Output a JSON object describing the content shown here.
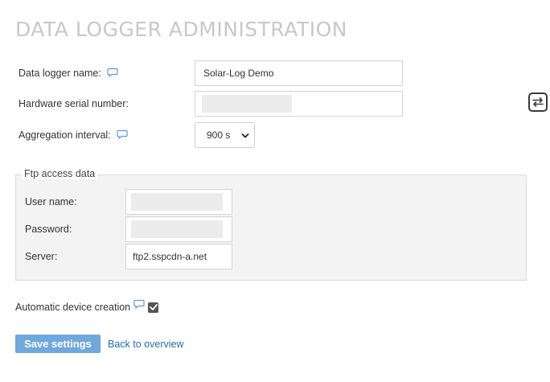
{
  "page": {
    "title": "DATA LOGGER ADMINISTRATION"
  },
  "form": {
    "logger_name_label": "Data logger name:",
    "logger_name_value": "Solar-Log Demo",
    "serial_label": "Hardware serial number:",
    "aggregation_label": "Aggregation interval:",
    "aggregation_value": "900 s"
  },
  "ftp": {
    "legend": "Ftp access data",
    "user_label": "User name:",
    "password_label": "Password:",
    "server_label": "Server:",
    "server_value": "ftp2.sspcdn-a.net"
  },
  "auto_device": {
    "label": "Automatic device creation",
    "checked": true
  },
  "actions": {
    "save_label": "Save settings",
    "back_label": "Back to overview"
  },
  "icons": {
    "help": "speech-bubble-icon",
    "swap": "swap-arrows-icon",
    "chevron": "chevron-down-icon",
    "check": "check-icon"
  },
  "colors": {
    "accent": "#6fa8dc",
    "link": "#1f6fb2",
    "title": "#c8c8c8",
    "help_icon": "#5b9bd5"
  }
}
